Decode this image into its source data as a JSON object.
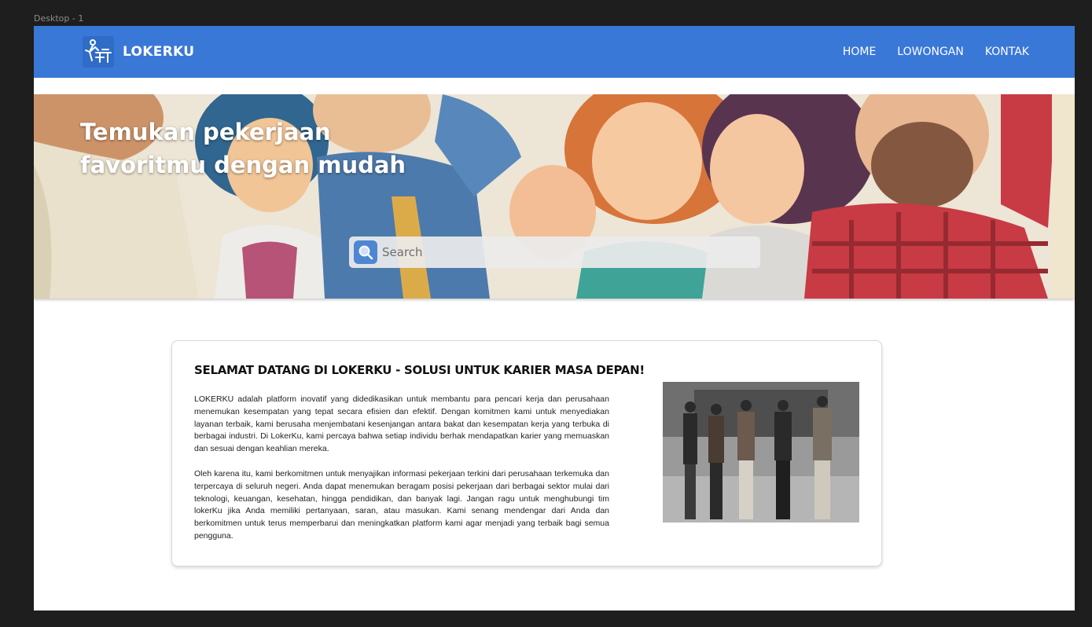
{
  "canvas": {
    "frame_label": "Desktop - 1"
  },
  "navbar": {
    "brand": "LOKERKU",
    "brand_icon": "person-at-desk-icon",
    "links": [
      "HOME",
      "LOWONGAN",
      "KONTAK"
    ]
  },
  "hero": {
    "title": "Temukan pekerjaan favoritmu dengan mudah",
    "search": {
      "placeholder": "Search",
      "icon": "search-icon"
    }
  },
  "about": {
    "title": "SELAMAT DATANG DI LOKERKU - SOLUSI UNTUK KARIER MASA DEPAN!",
    "paragraphs": [
      "LOKERKU adalah platform inovatif yang didedikasikan untuk membantu para pencari kerja dan perusahaan menemukan kesempatan yang tepat secara efisien dan efektif. Dengan komitmen kami untuk menyediakan layanan terbaik, kami berusaha menjembatani kesenjangan antara bakat dan kesempatan kerja yang terbuka di berbagai industri. Di LokerKu, kami percaya bahwa setiap individu berhak mendapatkan karier yang memuaskan dan sesuai dengan keahlian mereka.",
      "Oleh karena itu, kami berkomitmen untuk menyajikan informasi pekerjaan terkini dari perusahaan terkemuka dan terpercaya di seluruh negeri. Anda dapat menemukan beragam posisi pekerjaan dari berbagai sektor mulai dari teknologi, keuangan, kesehatan, hingga pendidikan, dan banyak lagi. Jangan ragu untuk menghubungi tim lokerKu jika Anda memiliki pertanyaan, saran, atau masukan. Kami senang mendengar dari Anda dan berkomitmen untuk terus memperbarui dan meningkatkan platform kami agar menjadi yang terbaik bagi semua pengguna."
    ]
  },
  "colors": {
    "navbar": "#3a78d8",
    "search_button": "#4f86d2",
    "canvas_background": "#1e1e1e"
  }
}
